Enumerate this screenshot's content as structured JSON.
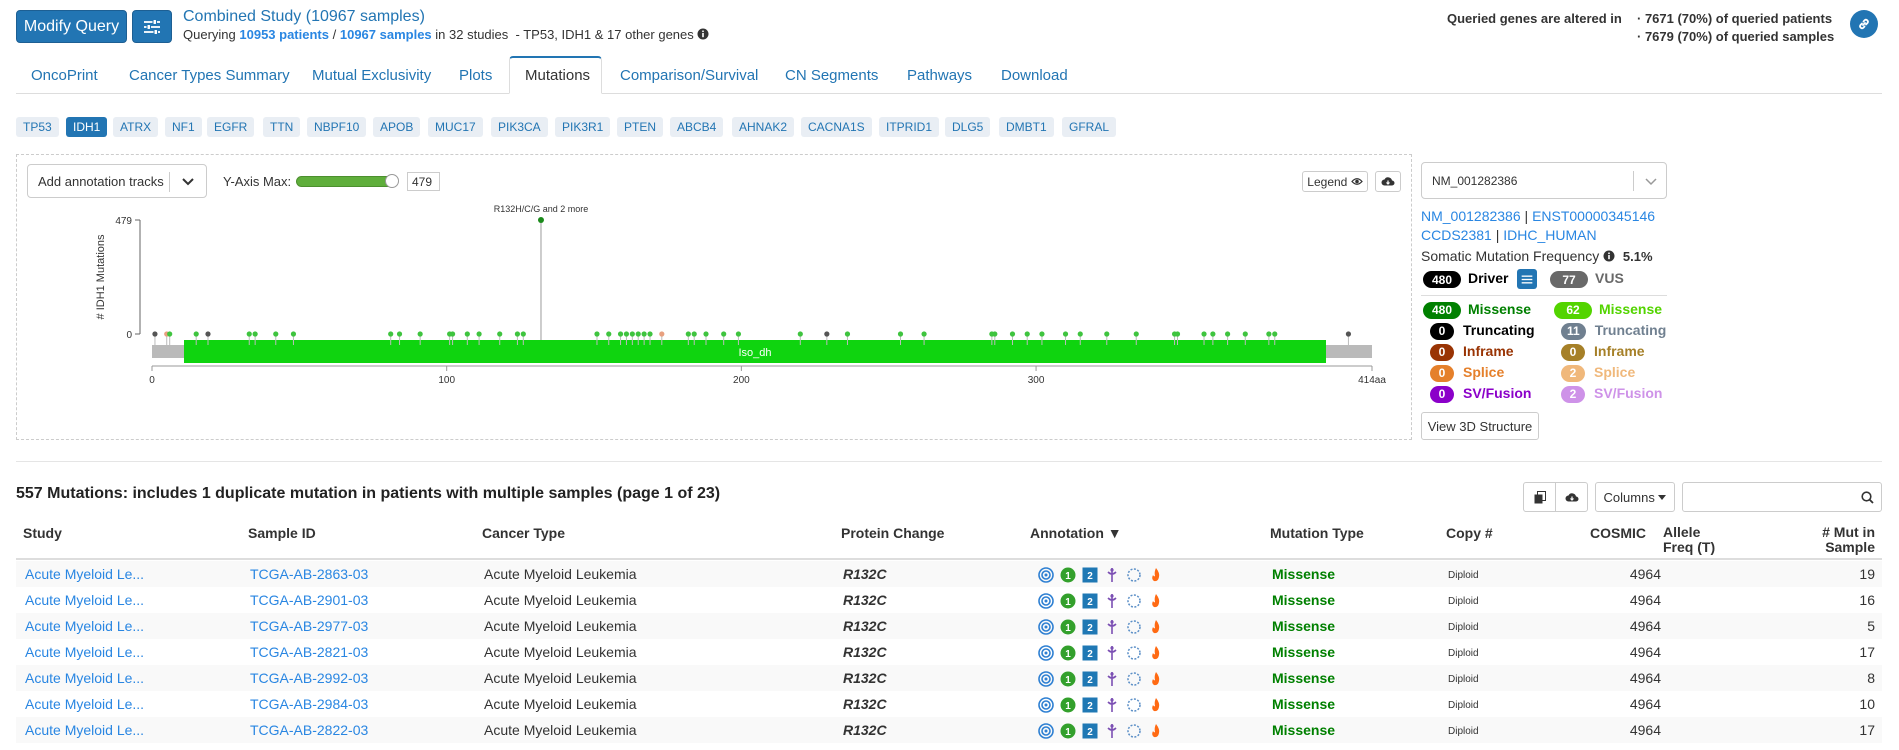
{
  "header": {
    "modify_query_label": "Modify Query",
    "study_title": "Combined Study (10967 samples)",
    "querying_prefix": "Querying",
    "patients_link": "10953 patients",
    "separator": "/",
    "samples_link": "10967 samples",
    "studies_text": "in 32 studies",
    "genes_text": "- TP53, IDH1 & 17 other genes",
    "altered_label": "Queried genes are altered in",
    "altered_patients": "· 7671 (70%) of queried patients",
    "altered_samples": "· 7679 (70%) of queried samples"
  },
  "tabs": [
    {
      "label": "OncoPrint"
    },
    {
      "label": "Cancer Types Summary"
    },
    {
      "label": "Mutual Exclusivity"
    },
    {
      "label": "Plots"
    },
    {
      "label": "Mutations"
    },
    {
      "label": "Comparison/Survival"
    },
    {
      "label": "CN Segments"
    },
    {
      "label": "Pathways"
    },
    {
      "label": "Download"
    }
  ],
  "genes": [
    {
      "label": "TP53"
    },
    {
      "label": "IDH1"
    },
    {
      "label": "ATRX"
    },
    {
      "label": "NF1"
    },
    {
      "label": "EGFR"
    },
    {
      "label": "TTN"
    },
    {
      "label": "NBPF10"
    },
    {
      "label": "APOB"
    },
    {
      "label": "MUC17"
    },
    {
      "label": "PIK3CA"
    },
    {
      "label": "PIK3R1"
    },
    {
      "label": "PTEN"
    },
    {
      "label": "ABCB4"
    },
    {
      "label": "AHNAK2"
    },
    {
      "label": "CACNA1S"
    },
    {
      "label": "ITPRID1"
    },
    {
      "label": "DLG5"
    },
    {
      "label": "DMBT1"
    },
    {
      "label": "GFRAL"
    }
  ],
  "plot": {
    "annotation_tracks_label": "Add annotation tracks",
    "y_axis_max_label": "Y-Axis Max:",
    "y_axis_max_value": "479",
    "legend_label": "Legend",
    "y_axis_label": "# IDH1 Mutations",
    "y_top_tick": "479",
    "y_bottom_tick": "0",
    "peak_label": "R132H/C/G and 2 more",
    "domain_label": "Iso_dh",
    "x_ticks": [
      "0",
      "100",
      "200",
      "300",
      "414aa"
    ],
    "protein_length": 414,
    "peak_position": 132
  },
  "side_panel": {
    "transcript_select": "NM_001282386",
    "links_line1_a": "NM_001282386",
    "links_line1_sep": "|",
    "links_line1_b": "ENST00000345146",
    "links_line2_a": "CCDS2381",
    "links_line2_sep": "|",
    "links_line2_b": "IDHC_HUMAN",
    "somatic_freq_label": "Somatic Mutation Frequency",
    "somatic_freq_value": "5.1%",
    "driver_count": "480",
    "driver_label": "Driver",
    "vus_count": "77",
    "vus_label": "VUS",
    "left_legend": [
      {
        "count": "480",
        "label": "Missense",
        "color": "#008000"
      },
      {
        "count": "0",
        "label": "Truncating",
        "color": "#000000"
      },
      {
        "count": "0",
        "label": "Inframe",
        "color": "#993404"
      },
      {
        "count": "0",
        "label": "Splice",
        "color": "#e5802b"
      },
      {
        "count": "0",
        "label": "SV/Fusion",
        "color": "#8b00c9"
      }
    ],
    "right_legend": [
      {
        "count": "62",
        "label": "Missense",
        "color": "#53d400"
      },
      {
        "count": "11",
        "label": "Truncating",
        "color": "#708090"
      },
      {
        "count": "0",
        "label": "Inframe",
        "color": "#a68028"
      },
      {
        "count": "2",
        "label": "Splice",
        "color": "#f0b87b"
      },
      {
        "count": "2",
        "label": "SV/Fusion",
        "color": "#ce92e8"
      }
    ],
    "view_3d_label": "View 3D Structure"
  },
  "table": {
    "title": "557 Mutations: includes 1 duplicate mutation in patients with multiple samples (page 1 of 23)",
    "columns_button": "Columns",
    "headers": {
      "study": "Study",
      "sample_id": "Sample ID",
      "cancer_type": "Cancer Type",
      "protein_change": "Protein Change",
      "annotation": "Annotation ▼",
      "mutation_type": "Mutation Type",
      "copy": "Copy #",
      "cosmic": "COSMIC",
      "allele_freq_1": "Allele",
      "allele_freq_2": "Freq (T)",
      "mut_in_sample_1": "# Mut in",
      "mut_in_sample_2": "Sample"
    },
    "rows": [
      {
        "study": "Acute Myeloid Le...",
        "sample": "TCGA-AB-2863-03",
        "cancer": "Acute Myeloid Leukemia",
        "protein": "R132C",
        "mtype": "Missense",
        "copy": "Diploid",
        "cosmic": "4964",
        "mut": "19"
      },
      {
        "study": "Acute Myeloid Le...",
        "sample": "TCGA-AB-2901-03",
        "cancer": "Acute Myeloid Leukemia",
        "protein": "R132C",
        "mtype": "Missense",
        "copy": "Diploid",
        "cosmic": "4964",
        "mut": "16"
      },
      {
        "study": "Acute Myeloid Le...",
        "sample": "TCGA-AB-2977-03",
        "cancer": "Acute Myeloid Leukemia",
        "protein": "R132C",
        "mtype": "Missense",
        "copy": "Diploid",
        "cosmic": "4964",
        "mut": "5"
      },
      {
        "study": "Acute Myeloid Le...",
        "sample": "TCGA-AB-2821-03",
        "cancer": "Acute Myeloid Leukemia",
        "protein": "R132C",
        "mtype": "Missense",
        "copy": "Diploid",
        "cosmic": "4964",
        "mut": "17"
      },
      {
        "study": "Acute Myeloid Le...",
        "sample": "TCGA-AB-2992-03",
        "cancer": "Acute Myeloid Leukemia",
        "protein": "R132C",
        "mtype": "Missense",
        "copy": "Diploid",
        "cosmic": "4964",
        "mut": "8"
      },
      {
        "study": "Acute Myeloid Le...",
        "sample": "TCGA-AB-2984-03",
        "cancer": "Acute Myeloid Leukemia",
        "protein": "R132C",
        "mtype": "Missense",
        "copy": "Diploid",
        "cosmic": "4964",
        "mut": "10"
      },
      {
        "study": "Acute Myeloid Le...",
        "sample": "TCGA-AB-2822-03",
        "cancer": "Acute Myeloid Leukemia",
        "protein": "R132C",
        "mtype": "Missense",
        "copy": "Diploid",
        "cosmic": "4964",
        "mut": "17"
      }
    ]
  },
  "colors": {
    "primary": "#2275b3",
    "link": "#2986e2",
    "missense_driver": "#008000",
    "domain_green": "#0fd40f"
  }
}
